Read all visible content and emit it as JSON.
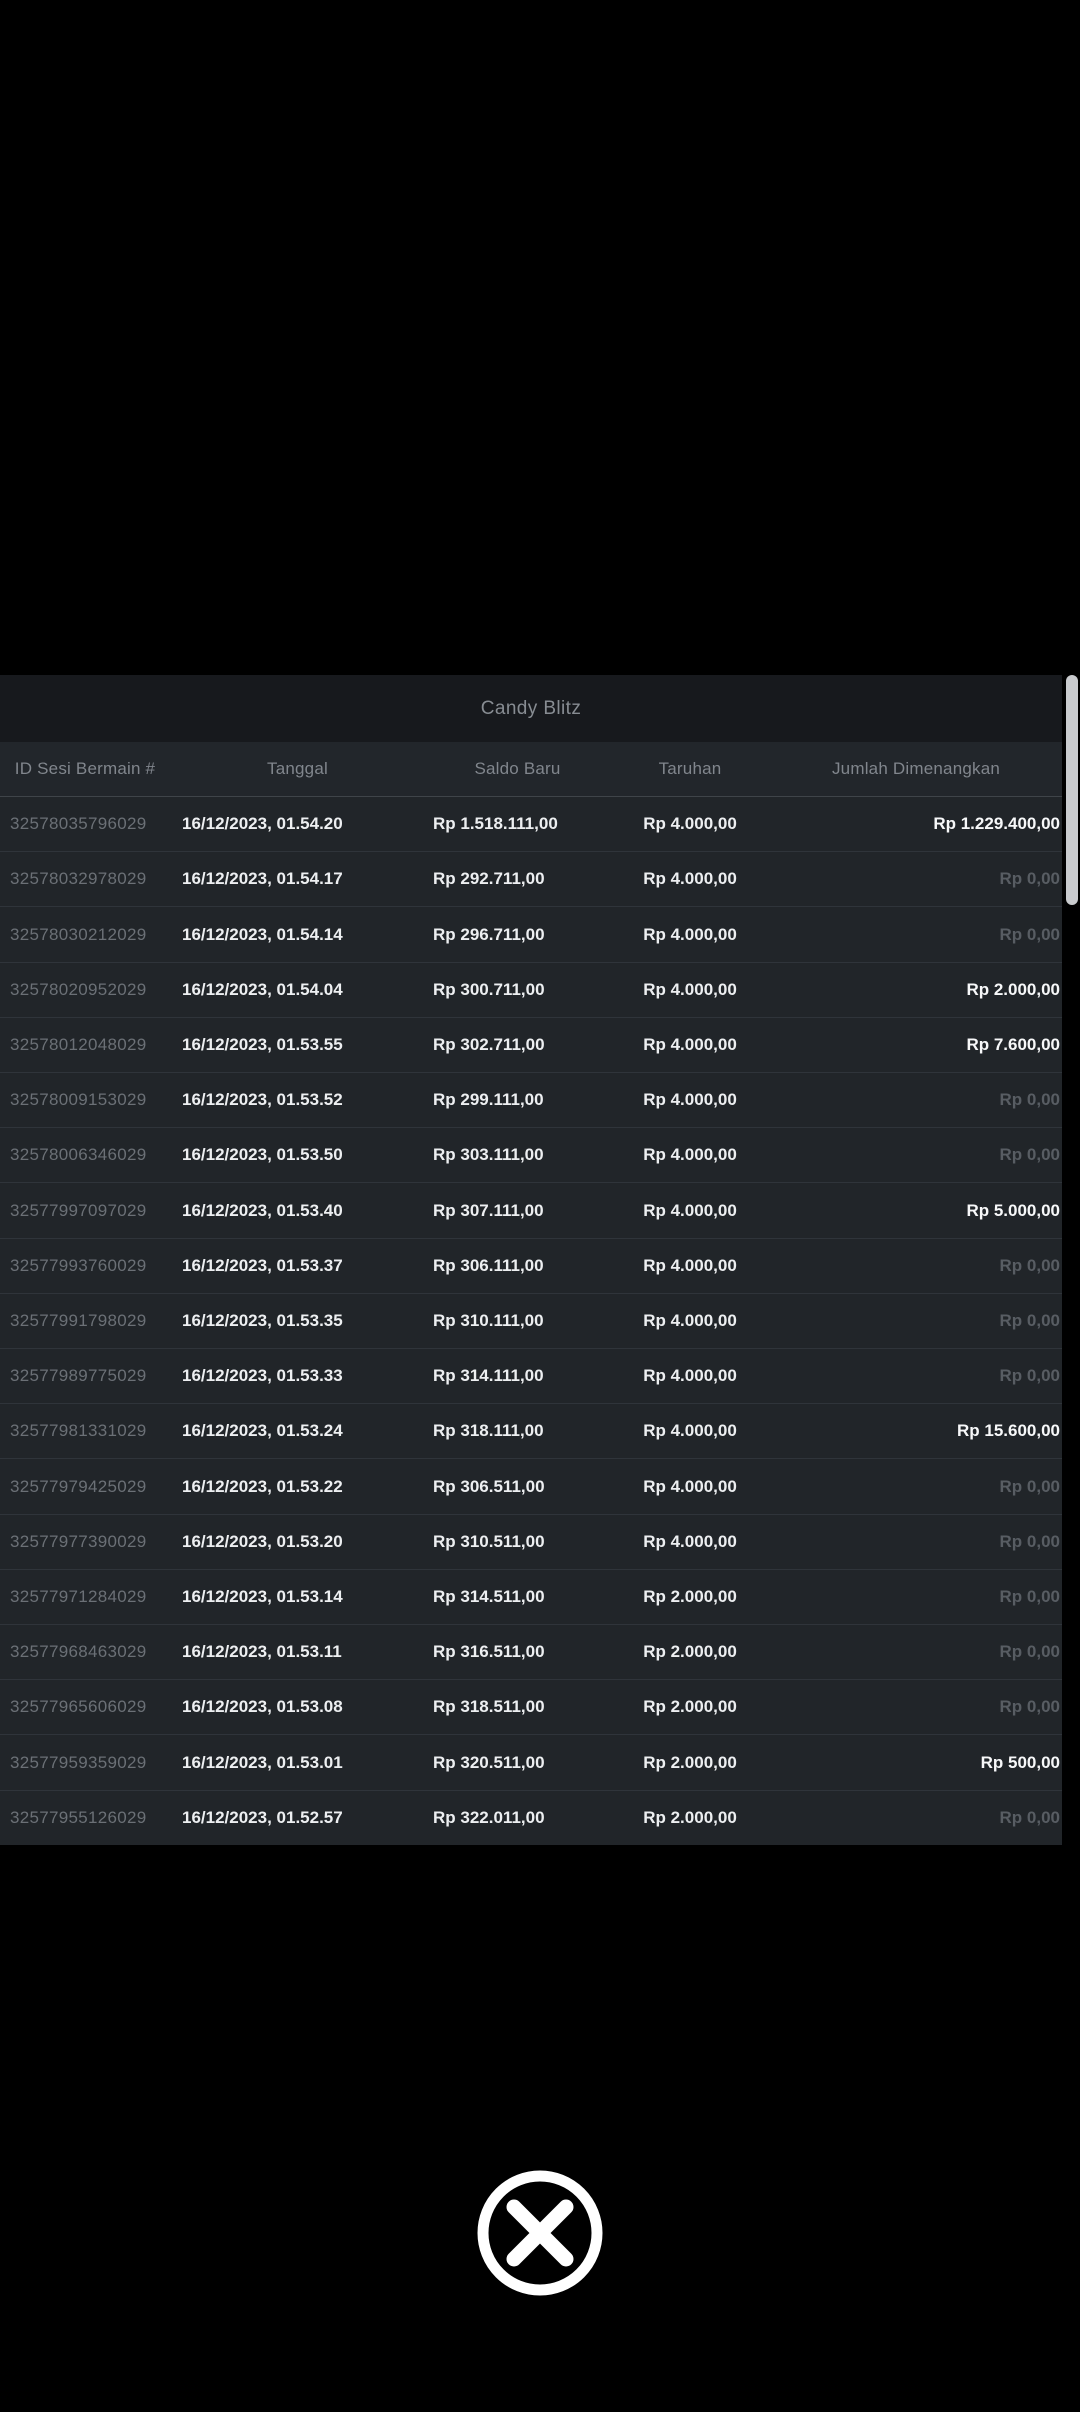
{
  "modal": {
    "title": "Candy Blitz",
    "columns": {
      "id": "ID Sesi Bermain #",
      "date": "Tanggal",
      "balance": "Saldo Baru",
      "bet": "Taruhan",
      "win": "Jumlah Dimenangkan"
    },
    "rows": [
      {
        "id": "32578035796029",
        "date": "16/12/2023, 01.54.20",
        "balance": "Rp 1.518.111,00",
        "bet": "Rp 4.000,00",
        "win": "Rp 1.229.400,00",
        "win_highlight": true
      },
      {
        "id": "32578032978029",
        "date": "16/12/2023, 01.54.17",
        "balance": "Rp 292.711,00",
        "bet": "Rp 4.000,00",
        "win": "Rp 0,00",
        "win_highlight": false
      },
      {
        "id": "32578030212029",
        "date": "16/12/2023, 01.54.14",
        "balance": "Rp 296.711,00",
        "bet": "Rp 4.000,00",
        "win": "Rp 0,00",
        "win_highlight": false
      },
      {
        "id": "32578020952029",
        "date": "16/12/2023, 01.54.04",
        "balance": "Rp 300.711,00",
        "bet": "Rp 4.000,00",
        "win": "Rp 2.000,00",
        "win_highlight": true
      },
      {
        "id": "32578012048029",
        "date": "16/12/2023, 01.53.55",
        "balance": "Rp 302.711,00",
        "bet": "Rp 4.000,00",
        "win": "Rp 7.600,00",
        "win_highlight": true
      },
      {
        "id": "32578009153029",
        "date": "16/12/2023, 01.53.52",
        "balance": "Rp 299.111,00",
        "bet": "Rp 4.000,00",
        "win": "Rp 0,00",
        "win_highlight": false
      },
      {
        "id": "32578006346029",
        "date": "16/12/2023, 01.53.50",
        "balance": "Rp 303.111,00",
        "bet": "Rp 4.000,00",
        "win": "Rp 0,00",
        "win_highlight": false
      },
      {
        "id": "32577997097029",
        "date": "16/12/2023, 01.53.40",
        "balance": "Rp 307.111,00",
        "bet": "Rp 4.000,00",
        "win": "Rp 5.000,00",
        "win_highlight": true
      },
      {
        "id": "32577993760029",
        "date": "16/12/2023, 01.53.37",
        "balance": "Rp 306.111,00",
        "bet": "Rp 4.000,00",
        "win": "Rp 0,00",
        "win_highlight": false
      },
      {
        "id": "32577991798029",
        "date": "16/12/2023, 01.53.35",
        "balance": "Rp 310.111,00",
        "bet": "Rp 4.000,00",
        "win": "Rp 0,00",
        "win_highlight": false
      },
      {
        "id": "32577989775029",
        "date": "16/12/2023, 01.53.33",
        "balance": "Rp 314.111,00",
        "bet": "Rp 4.000,00",
        "win": "Rp 0,00",
        "win_highlight": false
      },
      {
        "id": "32577981331029",
        "date": "16/12/2023, 01.53.24",
        "balance": "Rp 318.111,00",
        "bet": "Rp 4.000,00",
        "win": "Rp 15.600,00",
        "win_highlight": true
      },
      {
        "id": "32577979425029",
        "date": "16/12/2023, 01.53.22",
        "balance": "Rp 306.511,00",
        "bet": "Rp 4.000,00",
        "win": "Rp 0,00",
        "win_highlight": false
      },
      {
        "id": "32577977390029",
        "date": "16/12/2023, 01.53.20",
        "balance": "Rp 310.511,00",
        "bet": "Rp 4.000,00",
        "win": "Rp 0,00",
        "win_highlight": false
      },
      {
        "id": "32577971284029",
        "date": "16/12/2023, 01.53.14",
        "balance": "Rp 314.511,00",
        "bet": "Rp 2.000,00",
        "win": "Rp 0,00",
        "win_highlight": false
      },
      {
        "id": "32577968463029",
        "date": "16/12/2023, 01.53.11",
        "balance": "Rp 316.511,00",
        "bet": "Rp 2.000,00",
        "win": "Rp 0,00",
        "win_highlight": false
      },
      {
        "id": "32577965606029",
        "date": "16/12/2023, 01.53.08",
        "balance": "Rp 318.511,00",
        "bet": "Rp 2.000,00",
        "win": "Rp 0,00",
        "win_highlight": false
      },
      {
        "id": "32577959359029",
        "date": "16/12/2023, 01.53.01",
        "balance": "Rp 320.511,00",
        "bet": "Rp 2.000,00",
        "win": "Rp 500,00",
        "win_highlight": true
      },
      {
        "id": "32577955126029",
        "date": "16/12/2023, 01.52.57",
        "balance": "Rp 322.011,00",
        "bet": "Rp 2.000,00",
        "win": "Rp 0,00",
        "win_highlight": false
      }
    ]
  },
  "colors": {
    "page_bg": "#000000",
    "title_bar_bg": "#17191d",
    "header_bg": "#22262b",
    "row_bg": "#212529",
    "text_bright": "#edeff1",
    "text_dim_id": "#6b7076",
    "win_zero": "#585d63",
    "win_highlight": "#f7f8f9",
    "scrollbar": "#c9cbce",
    "close_button": "#ffffff"
  }
}
